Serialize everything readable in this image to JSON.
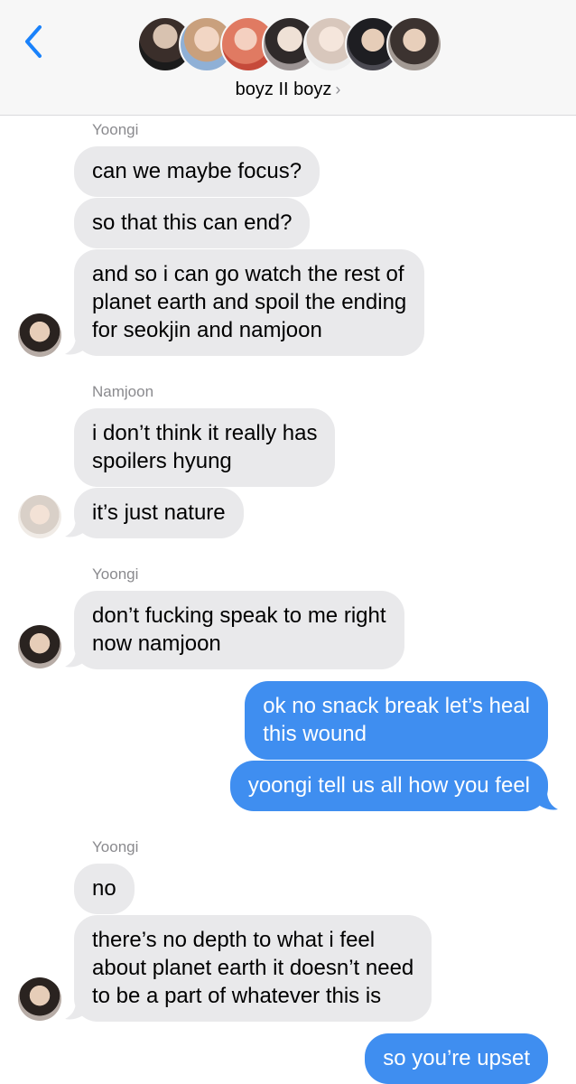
{
  "header": {
    "group_name": "boyz II boyz",
    "chevron": "›",
    "back_icon": "chevron-left-icon",
    "accent": "#1a82fb"
  },
  "colors": {
    "incoming": "#e9e9eb",
    "outgoing": "#3f8ef0"
  },
  "messages": [
    {
      "sender": "Yoongi",
      "bubbles": [
        "can we maybe focus?",
        "so that this can end?",
        "and so i can go watch the rest of\nplanet earth and spoil the ending\nfor seokjin and namjoon"
      ]
    },
    {
      "sender": "Namjoon",
      "bubbles": [
        "i don’t think it really has\nspoilers hyung",
        "it’s just nature"
      ]
    },
    {
      "sender": "Yoongi",
      "bubbles": [
        "don’t fucking speak to me right\nnow namjoon"
      ]
    },
    {
      "sender": "me",
      "bubbles": [
        "ok no snack break let’s heal\nthis wound",
        "yoongi tell us all how you feel"
      ]
    },
    {
      "sender": "Yoongi",
      "bubbles": [
        "no",
        "there’s no depth to what i feel\nabout planet earth it doesn’t need\nto be a part of whatever this is"
      ]
    },
    {
      "sender": "me",
      "bubbles": [
        "so you’re upset"
      ]
    }
  ]
}
